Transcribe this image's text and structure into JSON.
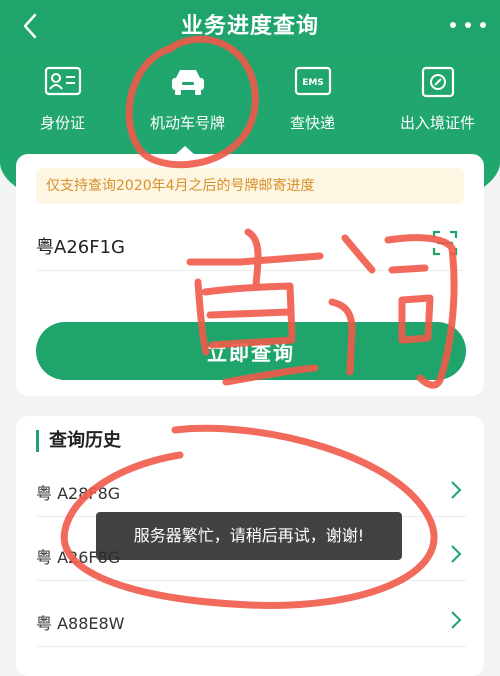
{
  "header": {
    "title": "业务进度查询"
  },
  "tabs": [
    {
      "label": "身份证",
      "icon": "id-card-icon"
    },
    {
      "label": "机动车号牌",
      "icon": "car-icon"
    },
    {
      "label": "查快递",
      "icon": "ems-icon",
      "badge": "EMS"
    },
    {
      "label": "出入境证件",
      "icon": "passport-icon"
    }
  ],
  "active_tab": 1,
  "notice": "仅支持查询2020年4月之后的号牌邮寄进度",
  "plate_input": {
    "value": "粤A26F1G"
  },
  "query_button": "立即查询",
  "history": {
    "title": "查询历史",
    "items": [
      {
        "plate": "粤 A28F8G"
      },
      {
        "plate": "粤 A26F8G"
      },
      {
        "plate": "粤 A88E8W"
      }
    ]
  },
  "toast": "服务器繁忙，请稍后再试，谢谢!",
  "colors": {
    "primary": "#1fa56c",
    "notice_text": "#d8902a",
    "annotation": "#f05a4a"
  }
}
